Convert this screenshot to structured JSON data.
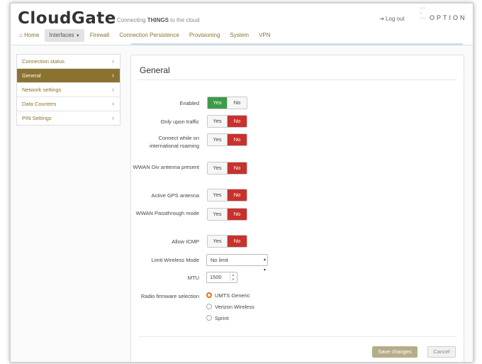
{
  "header": {
    "brand": "CloudGate",
    "tagline_pre": "Connecting ",
    "tagline_bold": "THINGS",
    "tagline_post": " to the cloud",
    "logout_label": "Log out",
    "option_brand": "OPTION"
  },
  "nav": {
    "items": [
      {
        "label": "Home",
        "icon": "home-icon"
      },
      {
        "label": "Interfaces"
      },
      {
        "label": "Firewall"
      },
      {
        "label": "Connection Persistence"
      },
      {
        "label": "Provisioning"
      },
      {
        "label": "System"
      },
      {
        "label": "VPN"
      }
    ],
    "active": "Interfaces"
  },
  "sidebar": {
    "items": [
      {
        "label": "Connection status"
      },
      {
        "label": "General"
      },
      {
        "label": "Network settings"
      },
      {
        "label": "Data Counters"
      },
      {
        "label": "PIN Settings"
      }
    ],
    "active": "General"
  },
  "panel": {
    "title": "General",
    "toggles": [
      {
        "label": "Enabled",
        "yes": "Yes",
        "no": "No",
        "value": "yes"
      },
      {
        "label": "Only upon traffic",
        "yes": "Yes",
        "no": "No",
        "value": "no"
      },
      {
        "label": "Connect while on international roaming",
        "yes": "Yes",
        "no": "No",
        "value": "no"
      },
      {
        "label": "WWAN Div antenna present",
        "yes": "Yes",
        "no": "No",
        "value": "no"
      },
      {
        "label": "Active GPS antenna",
        "yes": "Yes",
        "no": "No",
        "value": "no"
      },
      {
        "label": "WWAN Passthrough mode",
        "yes": "Yes",
        "no": "No",
        "value": "no"
      },
      {
        "label": "Allow ICMP",
        "yes": "Yes",
        "no": "No",
        "value": "no"
      }
    ],
    "wireless_mode": {
      "label": "Limit Wireless Mode",
      "value": "No limit"
    },
    "mtu": {
      "label": "MTU",
      "value": "1500"
    },
    "radio_firmware": {
      "label": "Radio firmware selection",
      "options": [
        "UMTS Generic",
        "Verizon Wireless",
        "Sprint"
      ],
      "selected": "UMTS Generic"
    },
    "save_label": "Save changes",
    "cancel_label": "Cancel"
  },
  "colors": {
    "accent": "#8a7230",
    "yes_on": "#3c9a48",
    "no_on": "#c8322d",
    "radio_selected": "#e07020"
  }
}
